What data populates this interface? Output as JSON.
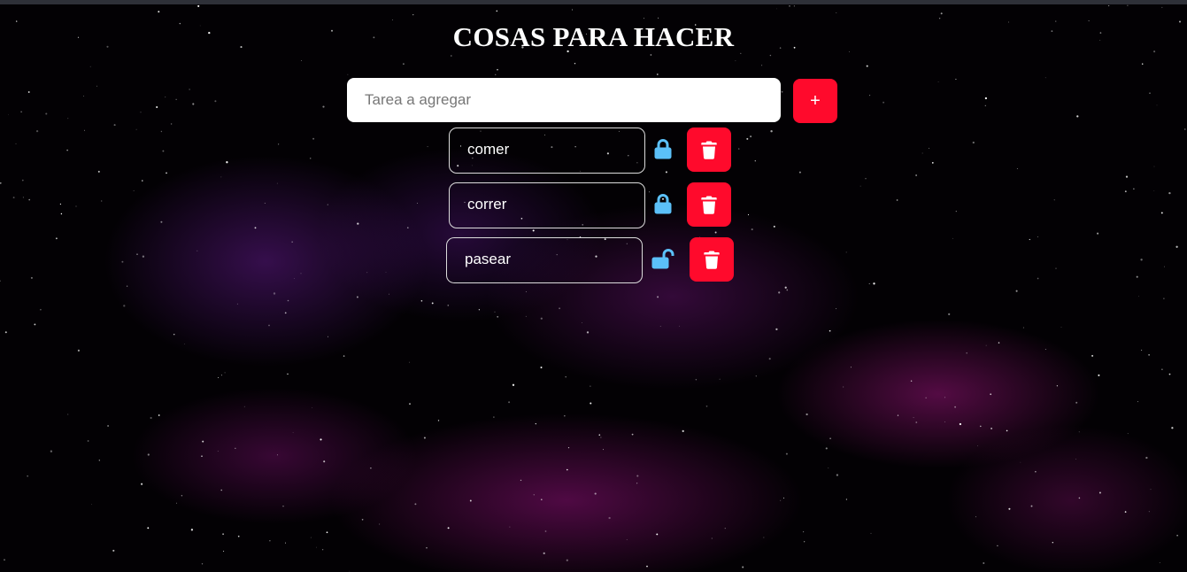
{
  "page": {
    "title": "COSAS PARA HACER"
  },
  "new_task": {
    "placeholder": "Tarea a agregar",
    "value": "",
    "add_label": "+"
  },
  "tasks": [
    {
      "text": "comer",
      "locked": true
    },
    {
      "text": "correr",
      "locked": true
    },
    {
      "text": "pasear",
      "locked": false
    }
  ],
  "icons": {
    "lock": "lock-icon",
    "unlock": "unlock-icon",
    "delete": "trash-icon"
  },
  "colors": {
    "accent": "#ff0a2c",
    "lock": "#5bc0f8",
    "text": "#ffffff",
    "background": "#000000",
    "nebula": "#8a1a8a"
  }
}
